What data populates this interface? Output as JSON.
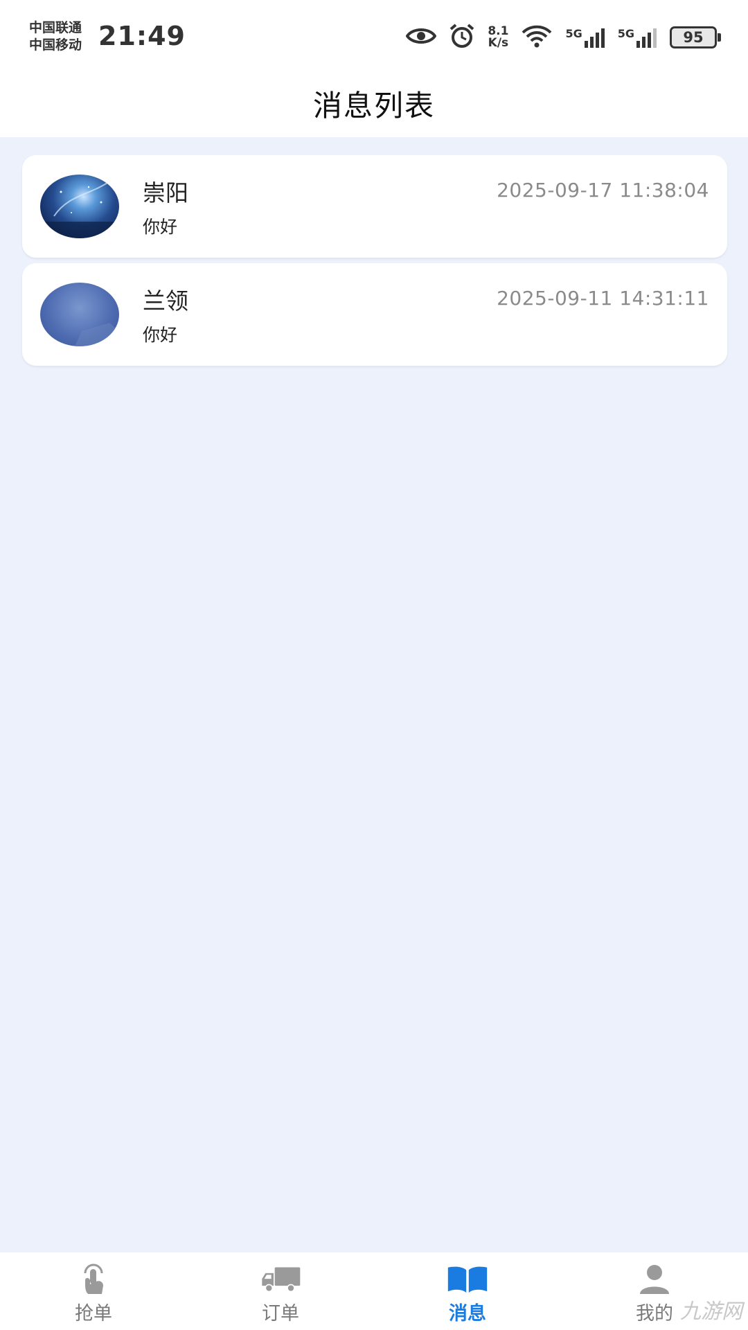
{
  "status_bar": {
    "carrier_1": "中国联通",
    "carrier_2": "中国移动",
    "time": "21:49",
    "net_speed_value": "8.1",
    "net_speed_unit": "K/s",
    "signal_1_label": "5G",
    "signal_2_label": "5G",
    "battery": "95",
    "icons": [
      "eye-icon",
      "alarm-icon",
      "wifi-icon",
      "signal-icon",
      "signal-icon",
      "battery-icon"
    ]
  },
  "header": {
    "title": "消息列表"
  },
  "messages": [
    {
      "name": "崇阳",
      "preview": "你好",
      "time": "2025-09-17 11:38:04"
    },
    {
      "name": "兰领",
      "preview": "你好",
      "time": "2025-09-11 14:31:11"
    }
  ],
  "bottom_nav": {
    "items": [
      {
        "label": "抢单",
        "icon": "tap-hand-icon",
        "active": false
      },
      {
        "label": "订单",
        "icon": "truck-icon",
        "active": false
      },
      {
        "label": "消息",
        "icon": "book-icon",
        "active": true
      },
      {
        "label": "我的",
        "icon": "user-icon",
        "active": false
      }
    ],
    "active_color": "#1a7ce0",
    "inactive_color": "#7a7a7a"
  },
  "watermark": "九游网"
}
